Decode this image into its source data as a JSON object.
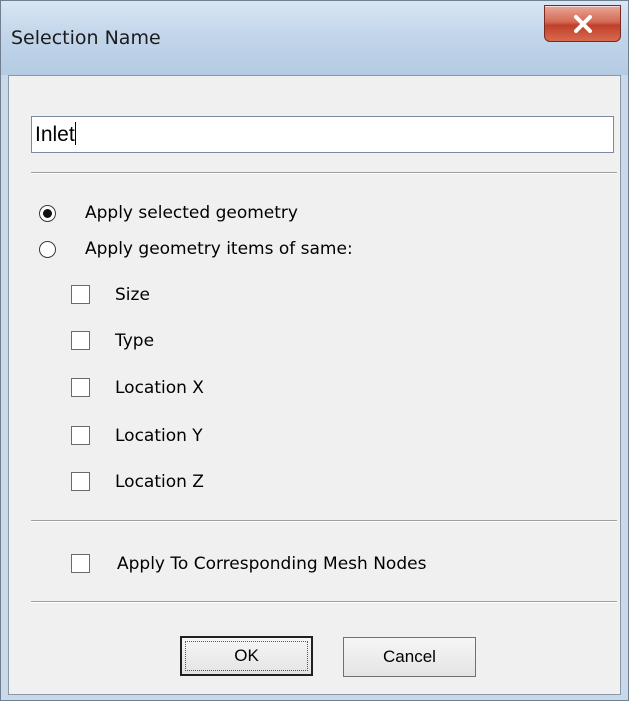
{
  "window": {
    "title": "Selection Name",
    "close_icon": "close-x-icon",
    "close_color": "#c0402a"
  },
  "name_field": {
    "value": "Inlet"
  },
  "radios": [
    {
      "label": "Apply selected geometry",
      "checked": true
    },
    {
      "label": "Apply geometry items of same:",
      "checked": false
    }
  ],
  "criteria": [
    {
      "label": "Size",
      "checked": false
    },
    {
      "label": "Type",
      "checked": false
    },
    {
      "label": "Location X",
      "checked": false
    },
    {
      "label": "Location Y",
      "checked": false
    },
    {
      "label": "Location Z",
      "checked": false
    }
  ],
  "mesh_option": {
    "label": "Apply To Corresponding Mesh Nodes",
    "checked": false
  },
  "buttons": {
    "ok_label": "OK",
    "cancel_label": "Cancel"
  }
}
